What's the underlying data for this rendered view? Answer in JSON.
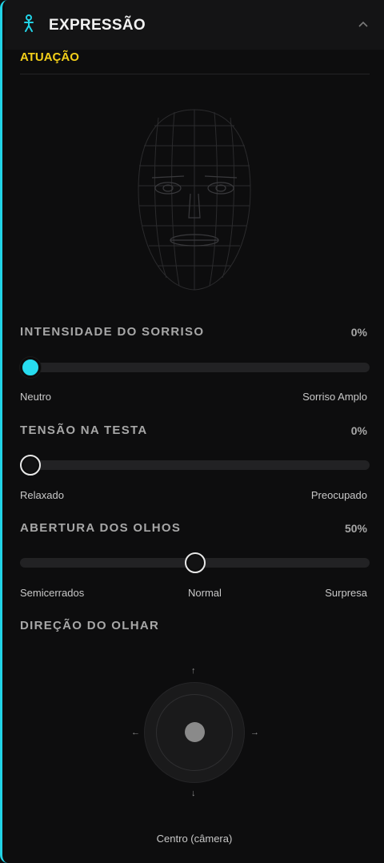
{
  "header": {
    "title": "EXPRESSÃO",
    "icon": "person-icon",
    "collapse_icon": "chevron-up-icon"
  },
  "section": {
    "title": "ATUAÇÃO"
  },
  "face_preview": {
    "icon": "face-mesh-icon"
  },
  "sliders": {
    "smile": {
      "label": "INTENSIDADE DO SORRISO",
      "value_text": "0%",
      "value": 0,
      "min_label": "Neutro",
      "max_label": "Sorriso Amplo"
    },
    "forehead": {
      "label": "TENSÃO NA TESTA",
      "value_text": "0%",
      "value": 0,
      "min_label": "Relaxado",
      "max_label": "Preocupado"
    },
    "eyes": {
      "label": "ABERTURA DOS OLHOS",
      "value_text": "50%",
      "value": 50,
      "min_label": "Semicerrados",
      "mid_label": "Normal",
      "max_label": "Surpresa"
    }
  },
  "gaze": {
    "label": "DIREÇÃO DO OLHAR",
    "arrows": {
      "up": "↑",
      "down": "↓",
      "left": "←",
      "right": "→"
    },
    "caption": "Centro (câmera)"
  },
  "colors": {
    "accent": "#22d3e6",
    "section": "#f3cf1a",
    "panel": "#0d0d0e"
  }
}
